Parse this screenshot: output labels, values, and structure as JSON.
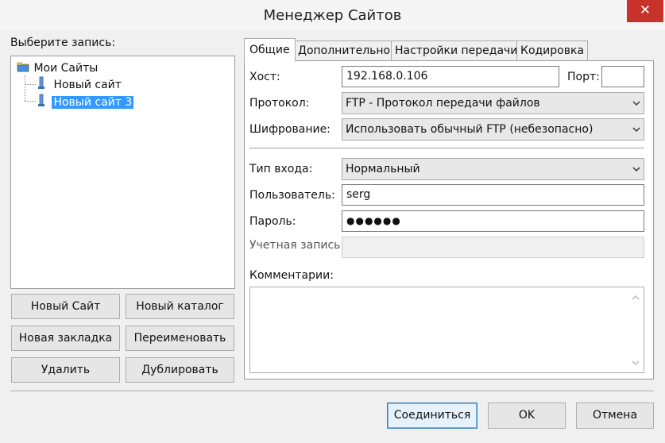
{
  "window": {
    "title": "Менеджер Сайтов",
    "close_glyph": "✕"
  },
  "left": {
    "select_label": "Выберите запись:",
    "tree": {
      "root": {
        "label": "Мои Сайты",
        "icon": "folder-icon"
      },
      "items": [
        {
          "label": "Новый сайт",
          "icon": "server-icon",
          "selected": false
        },
        {
          "label": "Новый сайт 3",
          "icon": "server-icon",
          "selected": true
        }
      ]
    },
    "buttons": {
      "new_site": "Новый Сайт",
      "new_folder": "Новый каталог",
      "new_bookmark": "Новая закладка",
      "rename": "Переименовать",
      "delete": "Удалить",
      "duplicate": "Дублировать"
    }
  },
  "tabs": [
    {
      "label": "Общие",
      "active": true
    },
    {
      "label": "Дополнительно",
      "active": false
    },
    {
      "label": "Настройки передачи",
      "active": false
    },
    {
      "label": "Кодировка",
      "active": false
    }
  ],
  "general": {
    "host": {
      "label": "Хост:",
      "value": "192.168.0.106"
    },
    "port": {
      "label": "Порт:",
      "value": ""
    },
    "protocol": {
      "label": "Протокол:",
      "value": "FTP - Протокол передачи файлов"
    },
    "encryption": {
      "label": "Шифрование:",
      "value": "Использовать обычный FTP (небезопасно)"
    },
    "logon_type": {
      "label": "Тип входа:",
      "value": "Нормальный"
    },
    "user": {
      "label": "Пользователь:",
      "value": "serg"
    },
    "password": {
      "label": "Пароль:",
      "value": "●●●●●●"
    },
    "account": {
      "label": "Учетная запись:",
      "value": ""
    },
    "comments": {
      "label": "Комментарии:",
      "value": ""
    }
  },
  "footer": {
    "connect": "Соединиться",
    "ok": "OK",
    "cancel": "Отмена"
  },
  "colors": {
    "close_red": "#c7332b",
    "selection_blue": "#3399ff"
  }
}
